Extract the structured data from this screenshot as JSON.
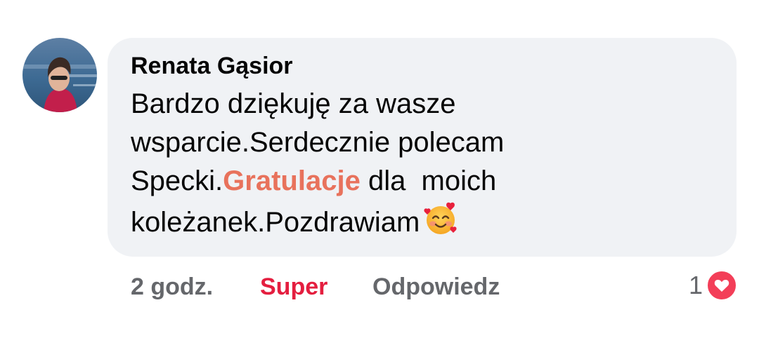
{
  "comment": {
    "author": "Renata Gąsior",
    "lines": [
      "Bardzo dziękuję za wasze",
      "wsparcie.Serdecznie polecam"
    ],
    "line3_prefix": "Specki.",
    "highlight": "Gratulacje",
    "line3_suffix": " dla  moich",
    "line4": "koleżanek.Pozdrawiam",
    "emoji_name": "smiling-face-with-hearts",
    "bubble_color": "#f0f2f5",
    "highlight_color": "#e8725c"
  },
  "actions": {
    "time": "2 godz.",
    "like": "Super",
    "reply": "Odpowiedz",
    "like_color": "#e41e3f"
  },
  "reactions": {
    "count": "1",
    "type": "love",
    "color": "#f33e58"
  }
}
